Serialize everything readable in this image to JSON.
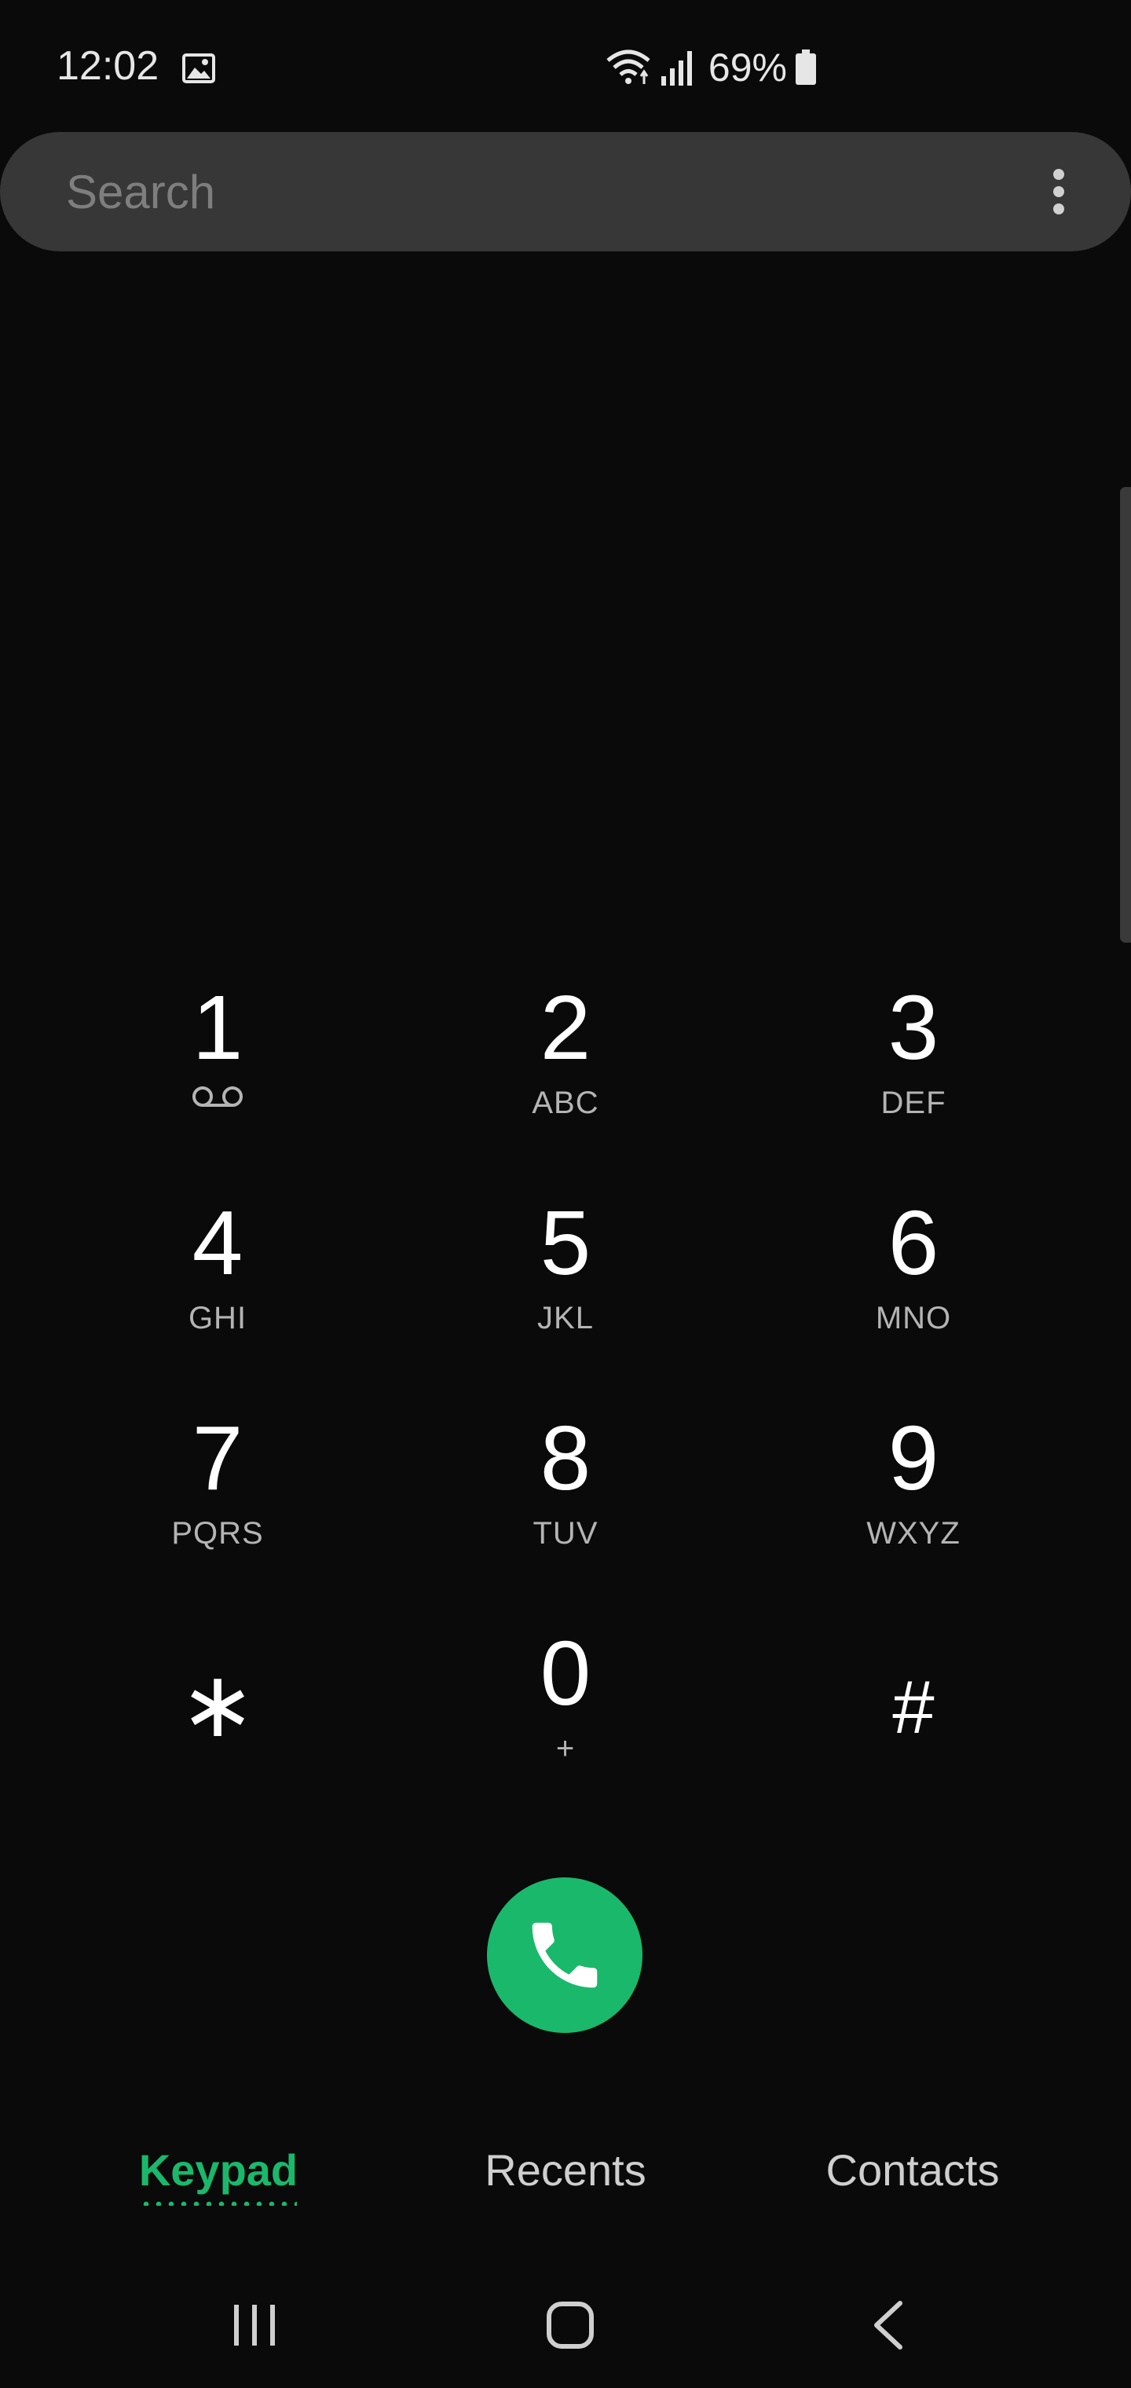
{
  "status_bar": {
    "time": "12:02",
    "battery_percent": "69%",
    "icons": [
      "gallery-icon",
      "wifi-icon",
      "signal-icon",
      "battery-icon"
    ]
  },
  "search": {
    "placeholder": "Search",
    "value": ""
  },
  "keypad": {
    "keys": [
      {
        "digit": "1",
        "letters": "",
        "extra_icon": "voicemail-icon"
      },
      {
        "digit": "2",
        "letters": "ABC"
      },
      {
        "digit": "3",
        "letters": "DEF"
      },
      {
        "digit": "4",
        "letters": "GHI"
      },
      {
        "digit": "5",
        "letters": "JKL"
      },
      {
        "digit": "6",
        "letters": "MNO"
      },
      {
        "digit": "7",
        "letters": "PQRS"
      },
      {
        "digit": "8",
        "letters": "TUV"
      },
      {
        "digit": "9",
        "letters": "WXYZ"
      },
      {
        "digit": "∗",
        "letters": ""
      },
      {
        "digit": "0",
        "letters": "+"
      },
      {
        "digit": "#",
        "letters": ""
      }
    ]
  },
  "tabs": [
    {
      "label": "Keypad",
      "active": true
    },
    {
      "label": "Recents",
      "active": false
    },
    {
      "label": "Contacts",
      "active": false
    }
  ],
  "colors": {
    "accent": "#1ab86b",
    "background": "#0a0a0a",
    "search_bar": "#373737"
  },
  "nav": {
    "icons": [
      "recent-apps-icon",
      "home-icon",
      "back-icon"
    ]
  }
}
